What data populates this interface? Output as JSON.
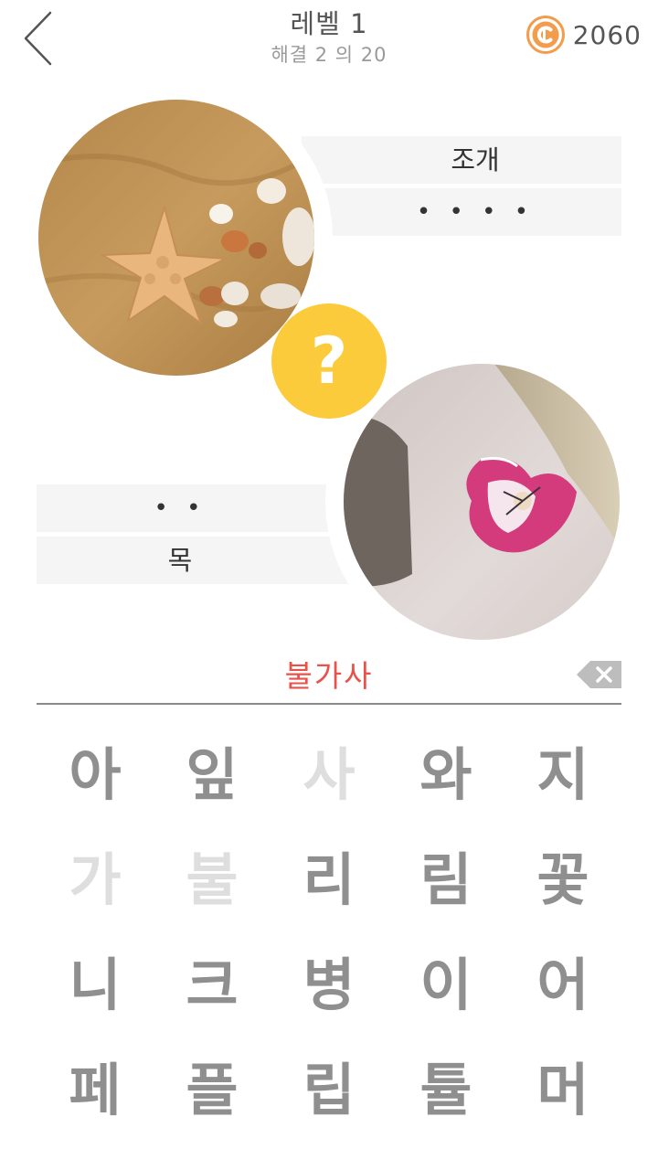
{
  "header": {
    "level_title": "레벨 1",
    "progress": "해결 2 의 20",
    "coins": "2060",
    "back_icon": "chevron-left-icon",
    "coin_icon": "coin-icon",
    "coin_color": "#f39c4b"
  },
  "puzzle": {
    "clue1": {
      "word": "조개",
      "hidden": "• • • •",
      "image": "starfish-seashells-on-sand"
    },
    "clue2": {
      "hidden": "• •",
      "word": "목",
      "image": "tulip-on-neck"
    },
    "hint_symbol": "?",
    "hint_color": "#fccb3c"
  },
  "answer": {
    "current": "불가사",
    "color": "#e8524a",
    "delete_icon": "backspace-icon"
  },
  "letters": [
    {
      "char": "아",
      "used": false
    },
    {
      "char": "잎",
      "used": false
    },
    {
      "char": "사",
      "used": true
    },
    {
      "char": "와",
      "used": false
    },
    {
      "char": "지",
      "used": false
    },
    {
      "char": "가",
      "used": true
    },
    {
      "char": "불",
      "used": true
    },
    {
      "char": "리",
      "used": false
    },
    {
      "char": "림",
      "used": false
    },
    {
      "char": "꽃",
      "used": false
    },
    {
      "char": "니",
      "used": false
    },
    {
      "char": "크",
      "used": false
    },
    {
      "char": "병",
      "used": false
    },
    {
      "char": "이",
      "used": false
    },
    {
      "char": "어",
      "used": false
    },
    {
      "char": "페",
      "used": false
    },
    {
      "char": "플",
      "used": false
    },
    {
      "char": "립",
      "used": false
    },
    {
      "char": "튤",
      "used": false
    },
    {
      "char": "머",
      "used": false
    }
  ]
}
